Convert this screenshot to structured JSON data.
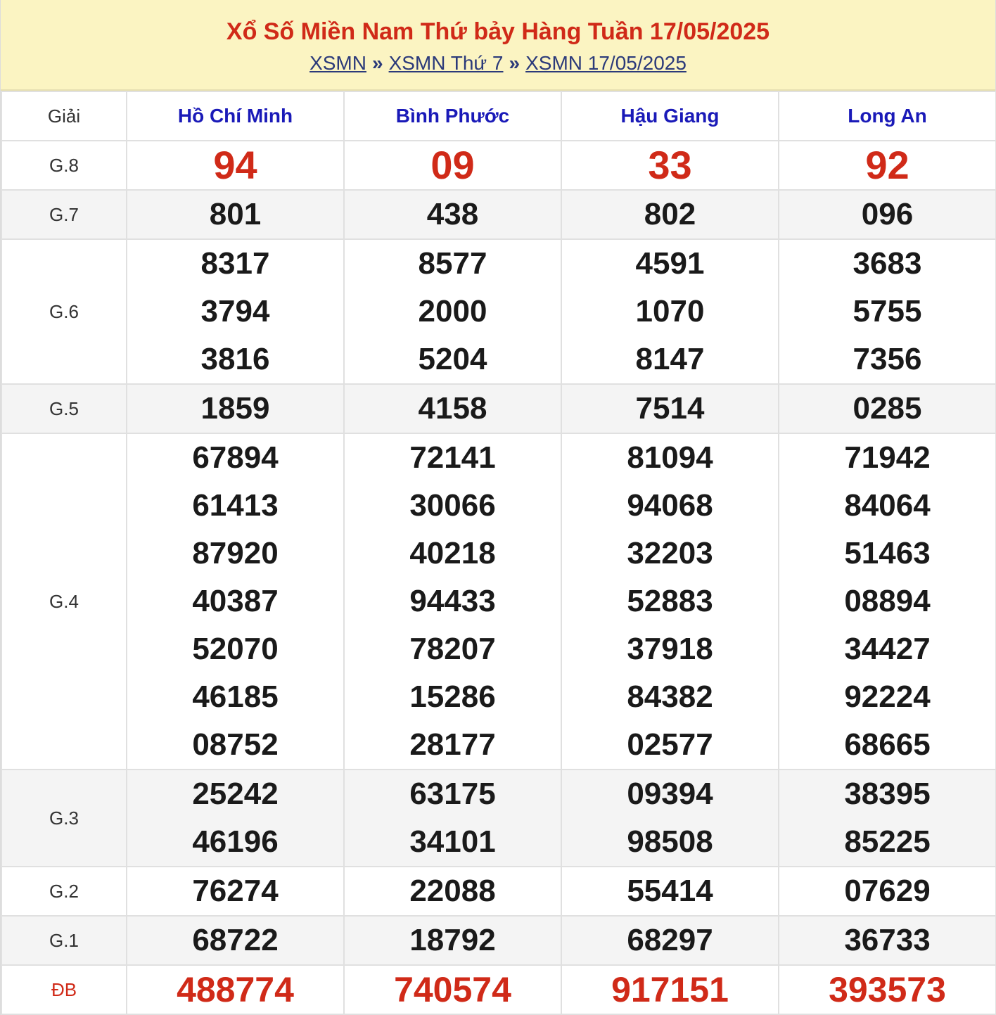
{
  "header": {
    "title": "Xổ Số Miền Nam Thứ bảy Hàng Tuần 17/05/2025",
    "breadcrumbs": [
      "XSMN",
      "XSMN Thứ 7",
      "XSMN 17/05/2025"
    ],
    "separator": "»"
  },
  "table": {
    "prize_header": "Giải",
    "provinces": [
      "Hồ Chí Minh",
      "Bình Phước",
      "Hậu Giang",
      "Long An"
    ],
    "rows": [
      {
        "prize": "G.8",
        "cols": [
          [
            "94"
          ],
          [
            "09"
          ],
          [
            "33"
          ],
          [
            "92"
          ]
        ]
      },
      {
        "prize": "G.7",
        "cols": [
          [
            "801"
          ],
          [
            "438"
          ],
          [
            "802"
          ],
          [
            "096"
          ]
        ]
      },
      {
        "prize": "G.6",
        "cols": [
          [
            "8317",
            "3794",
            "3816"
          ],
          [
            "8577",
            "2000",
            "5204"
          ],
          [
            "4591",
            "1070",
            "8147"
          ],
          [
            "3683",
            "5755",
            "7356"
          ]
        ]
      },
      {
        "prize": "G.5",
        "cols": [
          [
            "1859"
          ],
          [
            "4158"
          ],
          [
            "7514"
          ],
          [
            "0285"
          ]
        ]
      },
      {
        "prize": "G.4",
        "cols": [
          [
            "67894",
            "61413",
            "87920",
            "40387",
            "52070",
            "46185",
            "08752"
          ],
          [
            "72141",
            "30066",
            "40218",
            "94433",
            "78207",
            "15286",
            "28177"
          ],
          [
            "81094",
            "94068",
            "32203",
            "52883",
            "37918",
            "84382",
            "02577"
          ],
          [
            "71942",
            "84064",
            "51463",
            "08894",
            "34427",
            "92224",
            "68665"
          ]
        ]
      },
      {
        "prize": "G.3",
        "cols": [
          [
            "25242",
            "46196"
          ],
          [
            "63175",
            "34101"
          ],
          [
            "09394",
            "98508"
          ],
          [
            "38395",
            "85225"
          ]
        ]
      },
      {
        "prize": "G.2",
        "cols": [
          [
            "76274"
          ],
          [
            "22088"
          ],
          [
            "55414"
          ],
          [
            "07629"
          ]
        ]
      },
      {
        "prize": "G.1",
        "cols": [
          [
            "68722"
          ],
          [
            "18792"
          ],
          [
            "68297"
          ],
          [
            "36733"
          ]
        ]
      },
      {
        "prize": "ĐB",
        "cols": [
          [
            "488774"
          ],
          [
            "740574"
          ],
          [
            "917151"
          ],
          [
            "393573"
          ]
        ]
      }
    ]
  }
}
